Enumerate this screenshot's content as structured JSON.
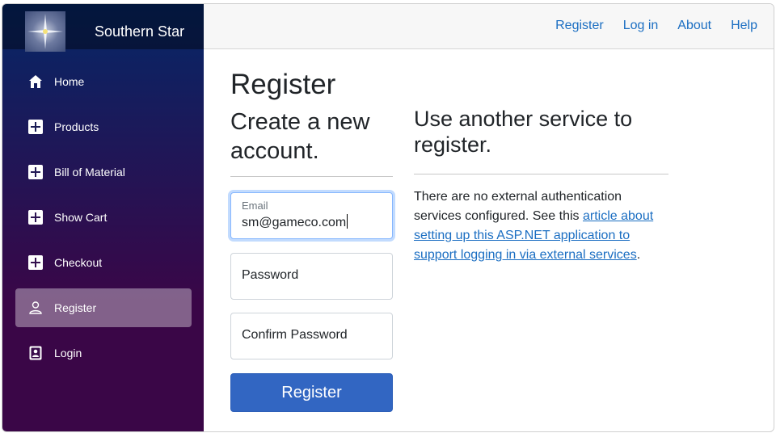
{
  "brand": {
    "name": "Southern Star",
    "logo_icon": "star-logo"
  },
  "sidebar": {
    "items": [
      {
        "label": "Home",
        "icon": "home-icon"
      },
      {
        "label": "Products",
        "icon": "plus-icon"
      },
      {
        "label": "Bill of Material",
        "icon": "plus-icon"
      },
      {
        "label": "Show Cart",
        "icon": "plus-icon"
      },
      {
        "label": "Checkout",
        "icon": "plus-icon"
      },
      {
        "label": "Register",
        "icon": "person-icon",
        "active": true
      },
      {
        "label": "Login",
        "icon": "badge-icon"
      }
    ]
  },
  "top_nav": {
    "register": "Register",
    "login": "Log in",
    "about": "About",
    "help": "Help"
  },
  "main": {
    "title": "Register",
    "subtitle_line1": "Create a new",
    "subtitle_line2": "account.",
    "form": {
      "email_label": "Email",
      "email_value": "sm@gameco.com",
      "password_placeholder": "Password",
      "confirm_placeholder": "Confirm Password",
      "submit_label": "Register"
    },
    "external": {
      "title_line1": "Use another service to",
      "title_line2": "register.",
      "text_before": "There are no external authentication services configured. See this ",
      "link_text": "article about setting up this ASP.NET application to support logging in via external services",
      "text_after": "."
    }
  },
  "colors": {
    "accent": "#1b6ec2",
    "button": "#3266c2",
    "sidebar_top": "#052767",
    "sidebar_bottom": "#3a0647"
  }
}
